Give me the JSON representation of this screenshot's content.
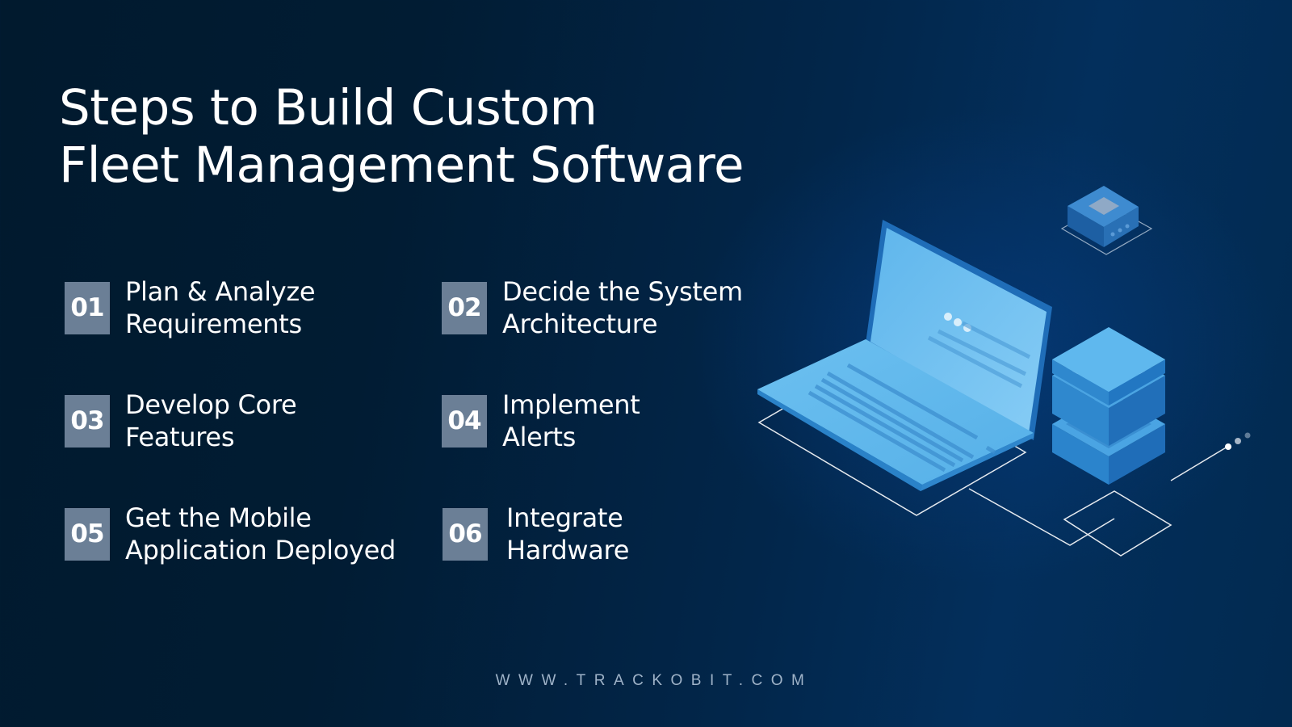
{
  "title": {
    "line1": "Steps to Build Custom",
    "line2": "Fleet Management Software"
  },
  "steps": [
    {
      "number": "01",
      "line1": "Plan & Analyze",
      "line2": "Requirements"
    },
    {
      "number": "02",
      "line1": "Decide the System",
      "line2": "Architecture"
    },
    {
      "number": "03",
      "line1": "Develop Core",
      "line2": "Features"
    },
    {
      "number": "04",
      "line1": "Implement",
      "line2": "Alerts"
    },
    {
      "number": "05",
      "line1": "Get the Mobile",
      "line2": "Application Deployed"
    },
    {
      "number": "06",
      "line1": "Integrate",
      "line2": "Hardware"
    }
  ],
  "footer": {
    "website": "WWW.TRACKOBIT.COM"
  },
  "illustration": {
    "description": "isometric-laptop-with-server-stack-and-device",
    "colors": {
      "light_blue": "#5fb8ee",
      "mid_blue": "#3d95d8",
      "dark_blue": "#1f6db8",
      "outline": "#ffffff",
      "number_box": "#6b7f96"
    }
  }
}
